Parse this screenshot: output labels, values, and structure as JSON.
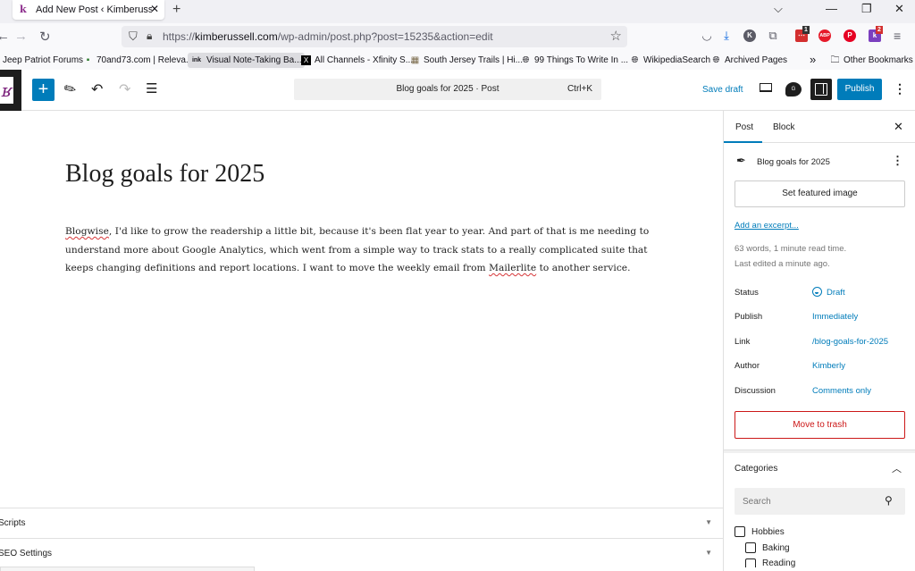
{
  "browser": {
    "tab_title": "Add New Post ‹ Kimberussell.co",
    "new_tab": "+",
    "window_controls": {
      "dropdown": "⌵",
      "minimize": "—",
      "restore": "❐",
      "close": "✕"
    },
    "url_prefix": "https://",
    "url_domain": "kimberussell.com",
    "url_path": "/wp-admin/post.php?post=15235&action=edit",
    "extensions": [
      {
        "name": "pocket",
        "glyph": "◡",
        "color": "#5b5b66"
      },
      {
        "name": "download",
        "glyph": "⤓",
        "color": "#0060df"
      },
      {
        "name": "k-extension",
        "glyph": "K",
        "color": "#5b5b66"
      },
      {
        "name": "puzzle",
        "glyph": "⧉",
        "color": "#5b5b66"
      },
      {
        "name": "todo-extension",
        "glyph": "⋯",
        "color": "#d32f2f",
        "badge": "1"
      },
      {
        "name": "adblock-plus",
        "glyph": "ABP",
        "color": "#e61a2a"
      },
      {
        "name": "pinterest",
        "glyph": "P",
        "color": "#e60023"
      },
      {
        "name": "k-purple-extension",
        "glyph": "k",
        "color": "#7b3fbf",
        "badge": "2"
      }
    ],
    "bookmarks": [
      {
        "label": "Jeep Patriot Forums",
        "icon": ""
      },
      {
        "label": "70and73.com | Releva...",
        "icon": "70"
      },
      {
        "label": "Visual Note-Taking Ba...",
        "icon": "ink",
        "active": true
      },
      {
        "label": "All Channels - Xfinity S...",
        "icon": "X"
      },
      {
        "label": "South Jersey Trails | Hi...",
        "icon": "▦"
      },
      {
        "label": "99 Things To Write In ...",
        "icon": "globe"
      },
      {
        "label": "WikipediaSearch",
        "icon": "globe"
      },
      {
        "label": "Archived Pages",
        "icon": "globe"
      }
    ],
    "more_bookmarks": "»",
    "other_bookmarks": "Other Bookmarks"
  },
  "toolbar": {
    "site_logo": "ʁ",
    "add_block": "+",
    "command_title": "Blog goals for 2025 · Post",
    "command_shortcut": "Ctrl+K",
    "save_draft": "Save draft",
    "jetpack": "G",
    "publish": "Publish",
    "more": "⋮"
  },
  "editor": {
    "title": "Blog goals for 2025",
    "body_parts": {
      "w1": "Blogwise",
      "t1": ", I'd like to grow the readership a little bit, because it's been flat year to year. And part of that is me needing to understand more about Google Analytics, which went from a simple way to track stats to a really complicated suite that keeps changing definitions and report locations. I want to move the weekly email from ",
      "w2": "Mailerlite",
      "t2": " to another service."
    },
    "metaboxes": [
      {
        "label": "Scripts"
      },
      {
        "label": "SEO Settings"
      }
    ]
  },
  "sidebar": {
    "tabs": [
      "Post",
      "Block"
    ],
    "active_tab": "Post",
    "close": "✕",
    "post_title": "Blog goals for 2025",
    "featured_image": "Set featured image",
    "add_excerpt": "Add an excerpt...",
    "word_count": "63 words, 1 minute read time.",
    "last_edited": "Last edited a minute ago.",
    "rows": [
      {
        "label": "Status",
        "value": "Draft"
      },
      {
        "label": "Publish",
        "value": "Immediately"
      },
      {
        "label": "Link",
        "value": "/blog-goals-for-2025"
      },
      {
        "label": "Author",
        "value": "Kimberly"
      },
      {
        "label": "Discussion",
        "value": "Comments only"
      }
    ],
    "trash": "Move to trash",
    "categories": {
      "title": "Categories",
      "search_placeholder": "Search",
      "items": [
        {
          "label": "Hobbies",
          "checked": false,
          "level": 0
        },
        {
          "label": "Baking",
          "checked": false,
          "level": 1
        },
        {
          "label": "Reading",
          "checked": false,
          "level": 1
        }
      ]
    }
  }
}
